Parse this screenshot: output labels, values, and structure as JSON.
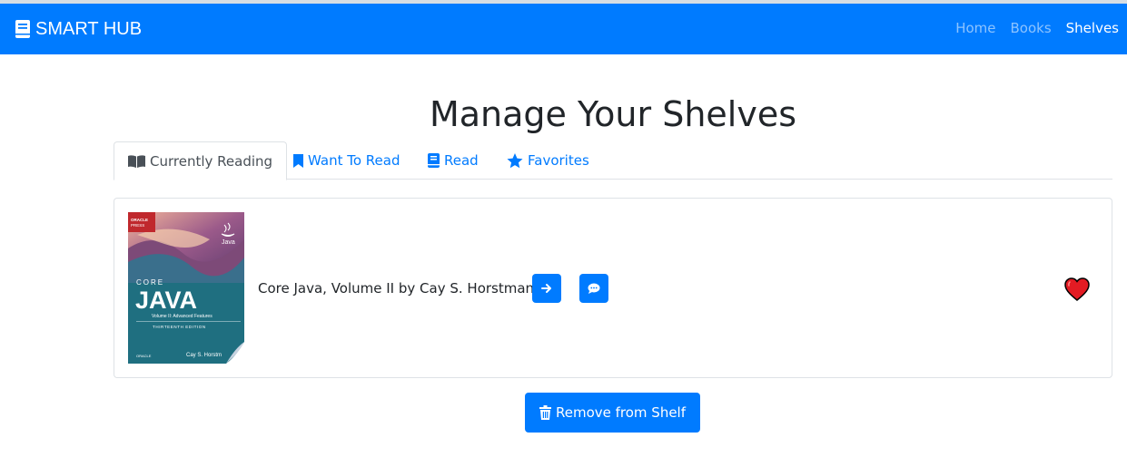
{
  "navbar": {
    "brand": "SMART HUB",
    "links": [
      {
        "label": "Home",
        "active": false
      },
      {
        "label": "Books",
        "active": false
      },
      {
        "label": "Shelves",
        "active": true
      }
    ]
  },
  "page": {
    "title": "Manage Your Shelves"
  },
  "tabs": [
    {
      "label": "Currently Reading",
      "icon": "book-open-icon",
      "active": true
    },
    {
      "label": "Want To Read",
      "icon": "bookmark-icon",
      "active": false
    },
    {
      "label": "Read",
      "icon": "book-icon",
      "active": false
    },
    {
      "label": "Favorites",
      "icon": "star-icon",
      "active": false
    }
  ],
  "book": {
    "entry": "Core Java, Volume II by Cay S. Horstmann",
    "cover": {
      "publisher_badge": "ORACLE PRESS",
      "series": "CORE",
      "title": "JAVA",
      "subtitle": "Volume II: Advanced Features",
      "edition": "THIRTEENTH EDITION",
      "publisher": "ORACLE",
      "author": "Cay S. Horstm",
      "brand_logo": "Java"
    },
    "actions": [
      "arrow-right-icon",
      "comment-icon"
    ],
    "favorite_icon": "heart-icon"
  },
  "remove_button": {
    "label": "Remove from Shelf",
    "icon": "trash-icon"
  },
  "colors": {
    "primary": "#007bff",
    "heart": "#e31b23",
    "cover_teal": "#1f6f80",
    "cover_red": "#c0282d"
  }
}
